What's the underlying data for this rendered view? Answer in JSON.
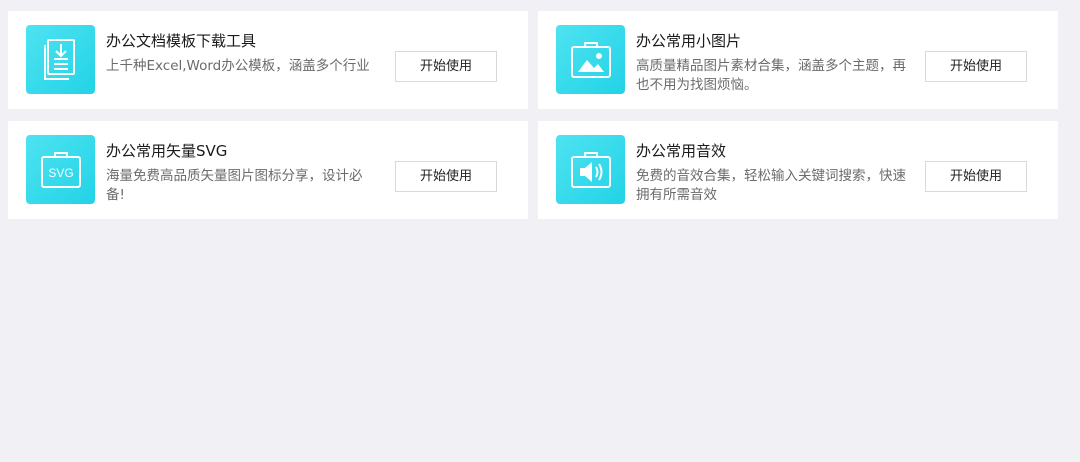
{
  "colors": {
    "page_background": "#f0f0f5",
    "card_background": "#ffffff",
    "icon_gradient_start": "#4ee3f2",
    "icon_gradient_end": "#22d3e6",
    "title_text": "#1a1a1a",
    "description_text": "#6b6b6b",
    "button_border": "#d9d9d9"
  },
  "tools": [
    {
      "icon": "document-download-icon",
      "title": "办公文档模板下载工具",
      "description": "上千种Excel,Word办公模板，涵盖多个行业",
      "button_label": "开始使用"
    },
    {
      "icon": "picture-bag-icon",
      "title": "办公常用小图片",
      "description": "高质量精品图片素材合集，涵盖多个主题，再也不用为找图烦恼。",
      "button_label": "开始使用"
    },
    {
      "icon": "svg-bag-icon",
      "icon_text": "SVG",
      "title": "办公常用矢量SVG",
      "description": "海量免费高品质矢量图片图标分享，设计必备!",
      "button_label": "开始使用"
    },
    {
      "icon": "speaker-bag-icon",
      "title": "办公常用音效",
      "description": "免费的音效合集，轻松输入关键词搜索，快速拥有所需音效",
      "button_label": "开始使用"
    }
  ]
}
